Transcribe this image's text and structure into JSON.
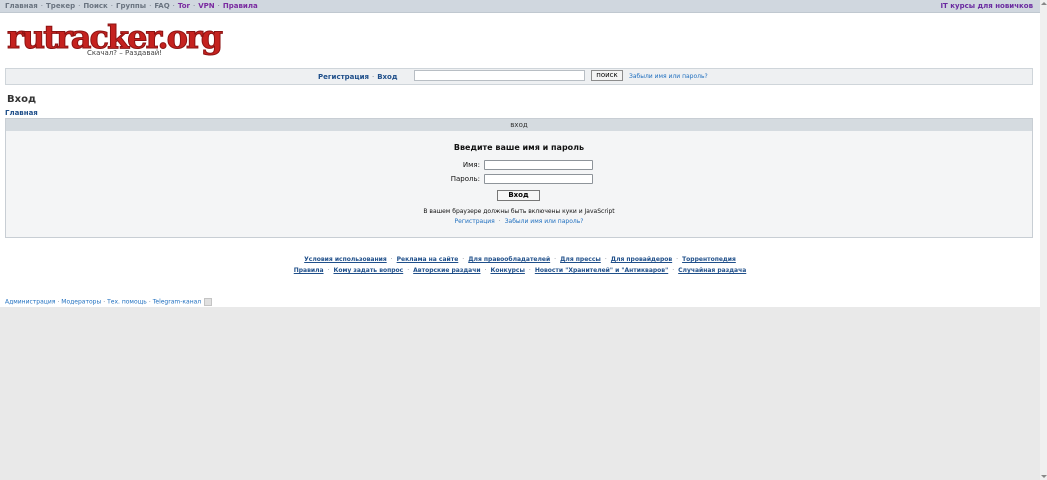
{
  "topnav": {
    "items": [
      {
        "label": "Главная"
      },
      {
        "label": "Трекер"
      },
      {
        "label": "Поиск"
      },
      {
        "label": "Группы"
      },
      {
        "label": "FAQ"
      },
      {
        "label": "Tor"
      },
      {
        "label": "VPN"
      },
      {
        "label": "Правила"
      }
    ],
    "separator": "·",
    "right_link": "IT курсы для новичков"
  },
  "logo": {
    "text_main": "rutracker",
    "text_org": ".org",
    "slogan": "Скачал? – Раздавай!"
  },
  "loginbar": {
    "register": "Регистрация",
    "login": "Вход",
    "separator": "·",
    "search_value": "",
    "search_button": "поиск",
    "forgot": "Забыли имя или пароль?"
  },
  "page_title": "Вход",
  "breadcrumb": "Главная",
  "login_panel": {
    "header": "вход",
    "form_title": "Введите ваше имя и пароль",
    "username_label": "Имя:",
    "username_value": "",
    "password_label": "Пароль:",
    "password_value": "",
    "submit": "Вход",
    "note": "В вашем браузере должны быть включены куки и JavaScript",
    "register": "Регистрация",
    "forgot": "Забыли имя или пароль?",
    "separator": "·"
  },
  "footer": {
    "separator": "·",
    "row1": [
      "Условия использования",
      "Реклама на сайте",
      "Для правообладателей",
      "Для прессы",
      "Для провайдеров",
      "Торрентопедия"
    ],
    "row2": [
      "Правила",
      "Кому задать вопрос",
      "Авторские раздачи",
      "Конкурсы",
      "Новости \"Хранителей\" и \"Антикваров\"",
      "Случайная раздача"
    ]
  },
  "bottom_links": [
    "Администрация",
    "Модераторы",
    "Тех. помощь",
    "Telegram-канал"
  ],
  "colors": {
    "topbar": "#d0d7df",
    "link": "#1f4f8a",
    "logo_red": "#c5221f",
    "accent_purple": "#7a2aa0"
  }
}
